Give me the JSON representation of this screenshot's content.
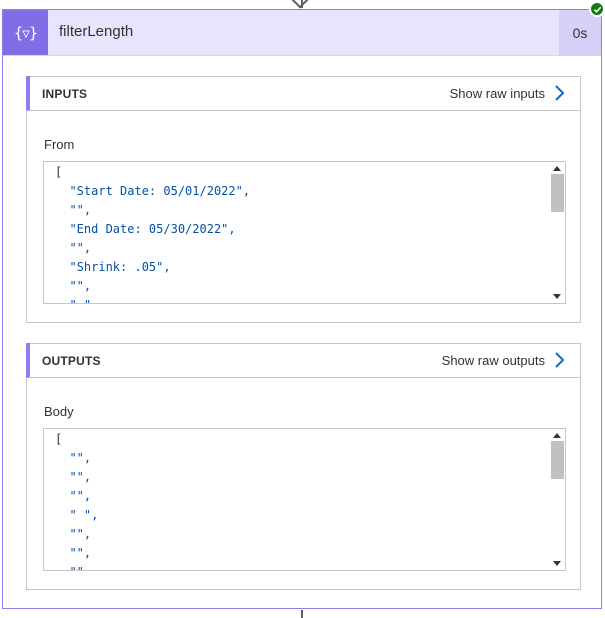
{
  "action": {
    "icon": "filter-array-icon",
    "icon_glyph": "{▿}",
    "title": "filterLength",
    "duration": "0s",
    "status": "succeeded",
    "accent_color": "#7f6ee6",
    "success_color": "#107c10"
  },
  "inputs": {
    "title": "INPUTS",
    "show_raw_label": "Show raw inputs",
    "field_label": "From",
    "lines": [
      "[",
      "  \"Start Date: 05/01/2022\",",
      "  \"\",",
      "  \"End Date: 05/30/2022\",",
      "  \"\",",
      "  \"Shrink: .05\",",
      "  \"\",",
      "  \" \""
    ]
  },
  "outputs": {
    "title": "OUTPUTS",
    "show_raw_label": "Show raw outputs",
    "field_label": "Body",
    "lines": [
      "[",
      "  \"\",",
      "  \"\",",
      "  \"\",",
      "  \" \",",
      "  \"\",",
      "  \"\",",
      "  \"\""
    ]
  }
}
